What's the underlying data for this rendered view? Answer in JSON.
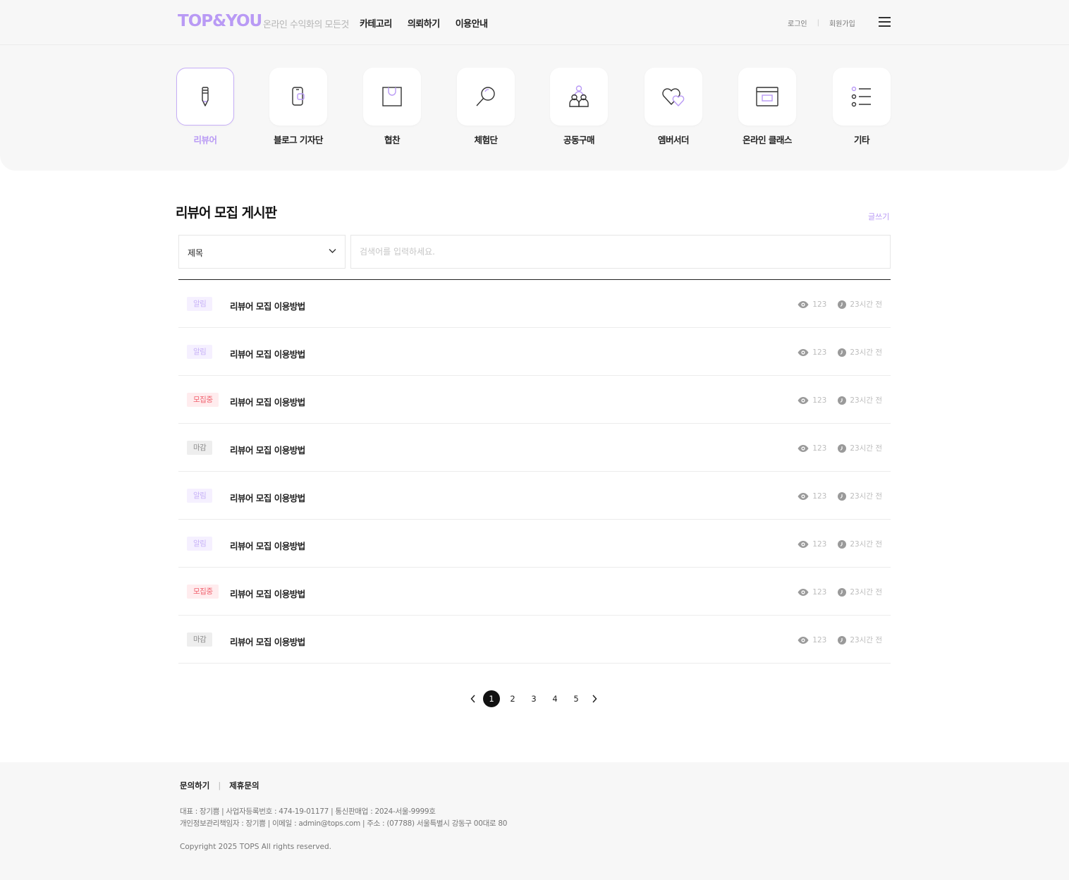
{
  "header": {
    "logo": "TOP&YOU",
    "tagline": "온라인 수익화의 모든것",
    "nav": [
      "카테고리",
      "의뢰하기",
      "이용안내"
    ],
    "login": "로그인",
    "signup": "회원가입",
    "separator": "|"
  },
  "categories": [
    {
      "label": "리뷰어",
      "icon": "pencil-icon"
    },
    {
      "label": "블로그 기자단",
      "icon": "phone-icon"
    },
    {
      "label": "협찬",
      "icon": "shopping-bag-icon"
    },
    {
      "label": "체험단",
      "icon": "magnifier-icon"
    },
    {
      "label": "공동구매",
      "icon": "group-icon"
    },
    {
      "label": "엠버서더",
      "icon": "hearts-icon"
    },
    {
      "label": "온라인 클래스",
      "icon": "browser-icon"
    },
    {
      "label": "기타",
      "icon": "list-icon"
    }
  ],
  "board": {
    "title": "리뷰어 모집 게시판",
    "write": "글쓰기",
    "select_value": "제목",
    "search_placeholder": "검색어를 입력하세요.",
    "rows": [
      {
        "badge": "알림",
        "type": "notice",
        "title": "리뷰어 모집 이용방법",
        "views": "123",
        "time": "23시간 전"
      },
      {
        "badge": "알림",
        "type": "notice",
        "title": "리뷰어 모집 이용방법",
        "views": "123",
        "time": "23시간 전"
      },
      {
        "badge": "모집중",
        "type": "open",
        "title": "리뷰어 모집 이용방법",
        "views": "123",
        "time": "23시간 전"
      },
      {
        "badge": "마감",
        "type": "closed",
        "title": "리뷰어 모집 이용방법",
        "views": "123",
        "time": "23시간 전"
      },
      {
        "badge": "알림",
        "type": "notice",
        "title": "리뷰어 모집 이용방법",
        "views": "123",
        "time": "23시간 전"
      },
      {
        "badge": "알림",
        "type": "notice",
        "title": "리뷰어 모집 이용방법",
        "views": "123",
        "time": "23시간 전"
      },
      {
        "badge": "모집중",
        "type": "open",
        "title": "리뷰어 모집 이용방법",
        "views": "123",
        "time": "23시간 전"
      },
      {
        "badge": "마감",
        "type": "closed",
        "title": "리뷰어 모집 이용방법",
        "views": "123",
        "time": "23시간 전"
      }
    ]
  },
  "pagination": {
    "pages": [
      "1",
      "2",
      "3",
      "4",
      "5"
    ],
    "current": "1"
  },
  "footer": {
    "links": [
      "문의하기",
      "제휴문의"
    ],
    "info_line1": "대표 : 장기쁨  |  사업자등록번호 : 474-19-01177  |  통신판매업 : 2024-서울-9999호",
    "info_line2": "개인정보관리책임자 : 장기쁨  |  이메일 : admin@tops.com  |  주소 : (07788) 서울특별시 강동구 00대로 80",
    "copyright": "Copyright  2025 TOPS All rights reserved."
  },
  "colors": {
    "brand": "#b99af5",
    "notice_badge": "#c7b1f7",
    "open_badge": "#f0616e",
    "closed_badge": "#8c8c8c"
  }
}
